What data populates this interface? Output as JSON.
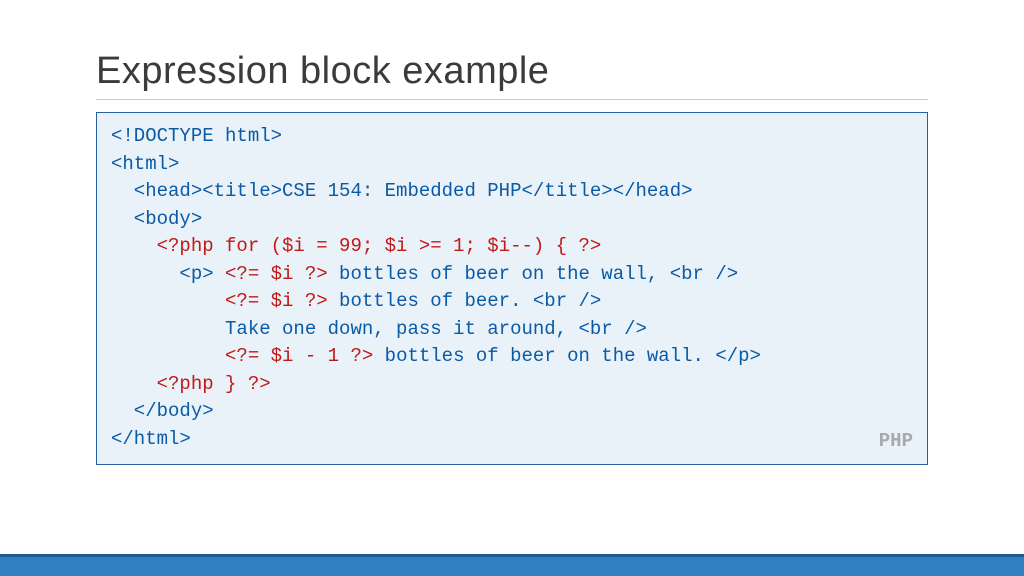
{
  "title": "Expression block example",
  "lang_badge": "PHP",
  "code": {
    "l1": "<!DOCTYPE html>",
    "l2": "<html>",
    "l3a": "  <head><title>",
    "l3b": "CSE 154: Embedded PHP",
    "l3c": "</title></head>",
    "l4": "  <body>",
    "l5": "    <?php for ($i = 99; $i >= 1; $i--) { ?>",
    "l6a": "      <p> ",
    "l6b": "<?= $i ?>",
    "l6c": " bottles of beer on the wall, <br />",
    "l7a": "          ",
    "l7b": "<?= $i ?>",
    "l7c": " bottles of beer. <br />",
    "l8": "          Take one down, pass it around, <br />",
    "l9a": "          ",
    "l9b": "<?= $i - 1 ?>",
    "l9c": " bottles of beer on the wall. </p>",
    "l10": "    <?php } ?>",
    "l11": "  </body>",
    "l12": "</html>"
  }
}
